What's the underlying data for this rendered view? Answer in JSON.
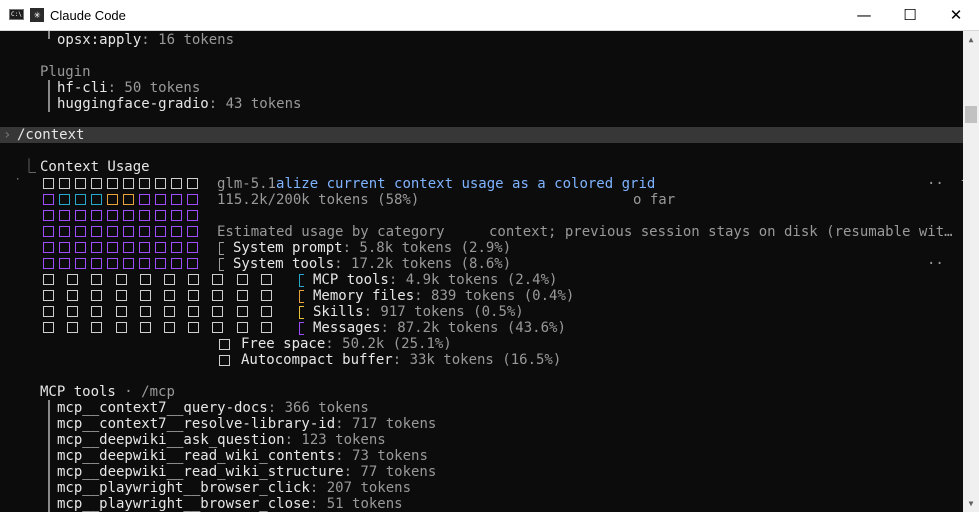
{
  "window": {
    "title": "Claude Code",
    "minimize": "—",
    "maximize": "☐",
    "close": "✕"
  },
  "top_lines": {
    "opsx_key": "opsx:apply",
    "opsx_val": ": 16 tokens",
    "plugin_heading": "Plugin",
    "hf_key": "hf-cli",
    "hf_val": ": 50 tokens",
    "hg_key": "huggingface-gradio",
    "hg_val": ": 43 tokens"
  },
  "prompt": {
    "symbol": "›",
    "command": "/context"
  },
  "context": {
    "heading_prefix": "⎿",
    "heading": "Context Usage",
    "model_line_a": "glm-5.1",
    "model_line_b": "alize current context usage as a colored grid",
    "usage_line": "115.2k/200k tokens (58%)",
    "usage_tail": "o far",
    "trail_dots_1": "··  t",
    "estimated": "Estimated usage by category",
    "estimated_tail": "context; previous session stays on disk (resumable wit…",
    "trail_dots_2": "··",
    "items": [
      {
        "label": "System prompt",
        "value": ": 5.8k tokens (2.9%)",
        "color": "#a0a0a0"
      },
      {
        "label": "System tools",
        "value": ": 17.2k tokens (8.6%)",
        "color": "#a0a0a0"
      },
      {
        "label": "MCP tools",
        "value": ": 4.9k tokens (2.4%)",
        "color": "#28a8c8"
      },
      {
        "label": "Memory files",
        "value": ": 839 tokens (0.4%)",
        "color": "#e8a33a"
      },
      {
        "label": "Skills",
        "value": ": 917 tokens (0.5%)",
        "color": "#e8c33a"
      },
      {
        "label": "Messages",
        "value": ": 87.2k tokens (43.6%)",
        "color": "#9b4dff"
      },
      {
        "label": "Free space",
        "value": ": 50.2k (25.1%)",
        "color": "#cfcfcf"
      },
      {
        "label": "Autocompact buffer",
        "value": ": 33k tokens (16.5%)",
        "color": "#cfcfcf"
      }
    ]
  },
  "mcp": {
    "heading": "MCP tools",
    "sep": " · ",
    "path": "/mcp",
    "tools": [
      {
        "name": "mcp__context7__query-docs",
        "tokens": ": 366 tokens"
      },
      {
        "name": "mcp__context7__resolve-library-id",
        "tokens": ": 717 tokens"
      },
      {
        "name": "mcp__deepwiki__ask_question",
        "tokens": ": 123 tokens"
      },
      {
        "name": "mcp__deepwiki__read_wiki_contents",
        "tokens": ": 73 tokens"
      },
      {
        "name": "mcp__deepwiki__read_wiki_structure",
        "tokens": ": 77 tokens"
      },
      {
        "name": "mcp__playwright__browser_click",
        "tokens": ": 207 tokens"
      },
      {
        "name": "mcp__playwright__browser_close",
        "tokens": ": 51 tokens"
      }
    ]
  }
}
